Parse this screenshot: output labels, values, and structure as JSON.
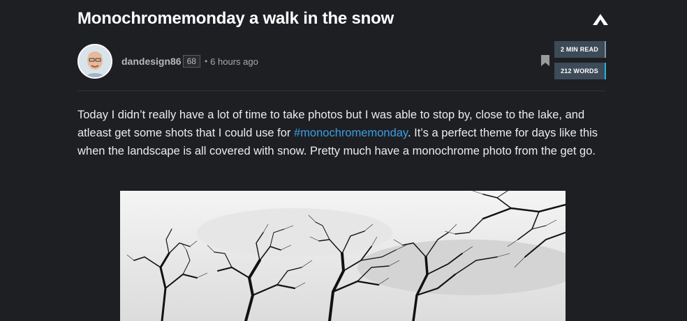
{
  "post": {
    "title": "Monochromemonday a walk in the snow",
    "author": {
      "name": "dandesign86",
      "reputation": "68",
      "separator": "•",
      "time_ago": "6 hours ago"
    },
    "stats": {
      "read_time": "2 MIN READ",
      "word_count": "212 WORDS"
    },
    "body": {
      "text_before": "Today I didn’t really have a lot of time to take photos but I was able to stop by, close to the lake, and atleast get some shots that I could use for ",
      "hashtag": "#monochromemonday",
      "text_after": ". It’s a perfect theme for days like this when the landscape is all covered with snow. Pretty much have a monochrome photo from the get go."
    }
  },
  "icons": {
    "collapse": "chevron-up-icon",
    "bookmark": "bookmark-icon"
  },
  "colors": {
    "background": "#1e1f23",
    "accent_link": "#3a9ee4",
    "stat_box": "#3d4a57",
    "words_accent": "#24b5d8"
  }
}
